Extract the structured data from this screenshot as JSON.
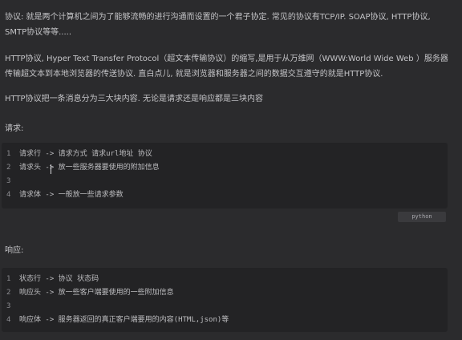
{
  "intro": {
    "protocol_def": "协议: 就是两个计算机之间为了能够流畅的进行沟通而设置的一个君子协定. 常见的协议有TCP/IP. SOAP协议, HTTP协议, SMTP协议等等.....",
    "http_def": "HTTP协议, Hyper Text Transfer Protocol（超文本传输协议）的缩写,是用于从万维网（WWW:World Wide Web ）服务器传输超文本到本地浏览器的传送协议. 直白点儿, 就是浏览器和服务器之间的数据交互遵守的就是HTTP协议.",
    "three_parts": "HTTP协议把一条消息分为三大块内容. 无论是请求还是响应都是三块内容"
  },
  "request": {
    "heading": "请求:",
    "lines": [
      {
        "num": "1",
        "text": "请求行 -> 请求方式 请求url地址 协议"
      },
      {
        "num": "2",
        "text": "请求头 -> 放一些服务器要使用的附加信息"
      },
      {
        "num": "3",
        "text": ""
      },
      {
        "num": "4",
        "text": "请求体 -> 一般放一些请求参数"
      }
    ],
    "language": "python"
  },
  "response": {
    "heading": "响应:",
    "lines": [
      {
        "num": "1",
        "text": "状态行 -> 协议 状态码"
      },
      {
        "num": "2",
        "text": "响应头 -> 放一些客户端要使用的一些附加信息"
      },
      {
        "num": "3",
        "text": ""
      },
      {
        "num": "4",
        "text": "响应体 -> 服务器返回的真正客户端要用的内容(HTML,json)等"
      }
    ]
  }
}
